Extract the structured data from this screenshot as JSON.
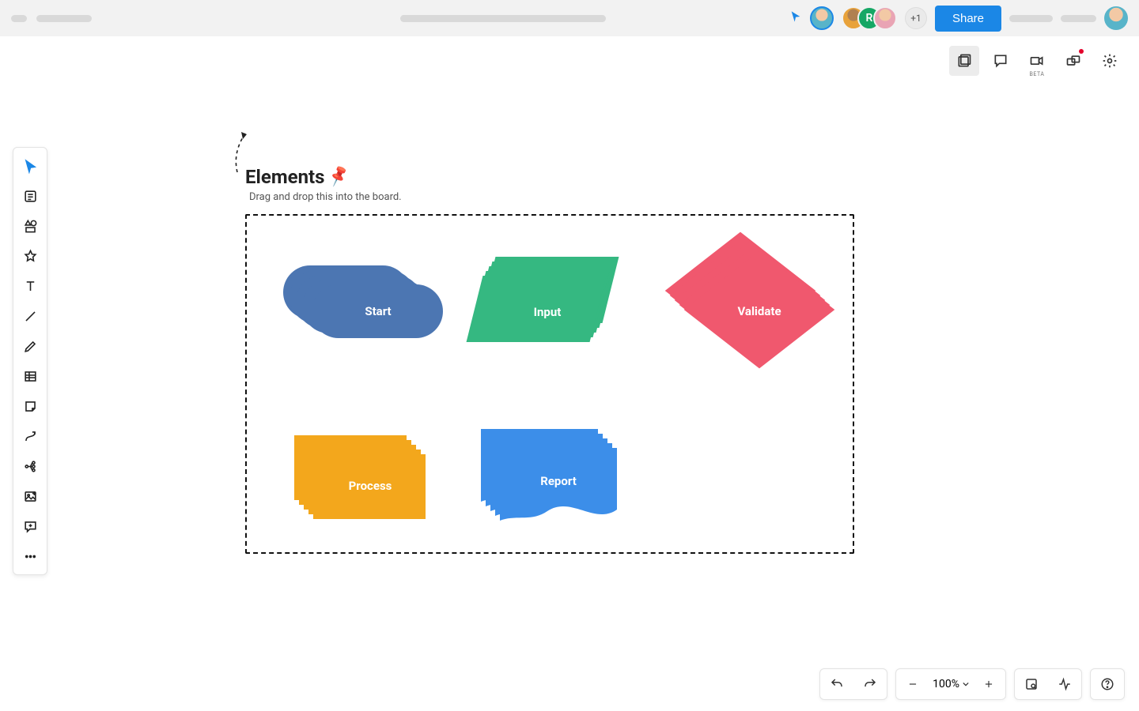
{
  "header": {
    "share_label": "Share",
    "extra_count": "+1",
    "avatar_r_letter": "R"
  },
  "right_actions": {
    "beta_label": "BETA"
  },
  "canvas": {
    "title": "Elements",
    "subtitle": "Drag and drop this into the board.",
    "shapes": {
      "start": {
        "label": "Start",
        "type": "terminator",
        "color": "#4c76b2"
      },
      "input": {
        "label": "Input",
        "type": "parallelogram",
        "color": "#35b881"
      },
      "validate": {
        "label": "Validate",
        "type": "decision",
        "color": "#f0586e"
      },
      "process": {
        "label": "Process",
        "type": "process",
        "color": "#f3a71c"
      },
      "report": {
        "label": "Report",
        "type": "document",
        "color": "#3c8ee9"
      }
    }
  },
  "bottombar": {
    "zoom": "100%"
  }
}
